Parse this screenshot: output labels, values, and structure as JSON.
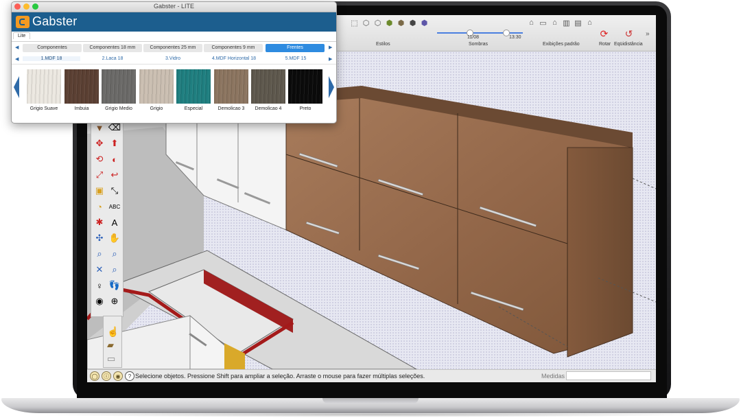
{
  "toolbar": {
    "groups": [
      {
        "label": "Estilos"
      },
      {
        "label": "Sombras"
      },
      {
        "label": "Exibições padrão"
      },
      {
        "label": "Rotar"
      },
      {
        "label": "Eqüidistância"
      }
    ],
    "shadow_date": "11/08",
    "shadow_time": "13:30",
    "overflow": "»"
  },
  "status": {
    "message": "Selecione objetos. Pressione Shift para ampliar a seleção. Arraste o mouse para fazer múltiplas seleções.",
    "medidas_label": "Medidas",
    "medidas_value": ""
  },
  "gabster": {
    "window_title": "Gabster - LITE",
    "brand": "Gabster",
    "tab": "Lite",
    "categories": [
      "Componentes",
      "Componentes 18 mm",
      "Componentes 25 mm",
      "Componentes 9 mm",
      "Frentes"
    ],
    "subcategories": [
      "1.MDF 18",
      "2.Laca 18",
      "3.Vidro",
      "4.MDF Horizontal 18",
      "5.MDF 15"
    ],
    "swatches": [
      {
        "name": "Grigio Suave",
        "color": "#ece8e1"
      },
      {
        "name": "Imbuia",
        "color": "#5b4033"
      },
      {
        "name": "Grigio Medio",
        "color": "#6b6a68"
      },
      {
        "name": "Grigio",
        "color": "#cbbfb2"
      },
      {
        "name": "Especial",
        "color": "#1f7f80"
      },
      {
        "name": "Demolicao 3",
        "color": "#8c7560"
      },
      {
        "name": "Demolicao 4",
        "color": "#5e584d"
      },
      {
        "name": "Preto",
        "color": "#0b0b0b"
      }
    ]
  },
  "colors": {
    "accent": "#2e8be0",
    "header": "#1c5e8e",
    "wood": "#9a6d4e"
  }
}
